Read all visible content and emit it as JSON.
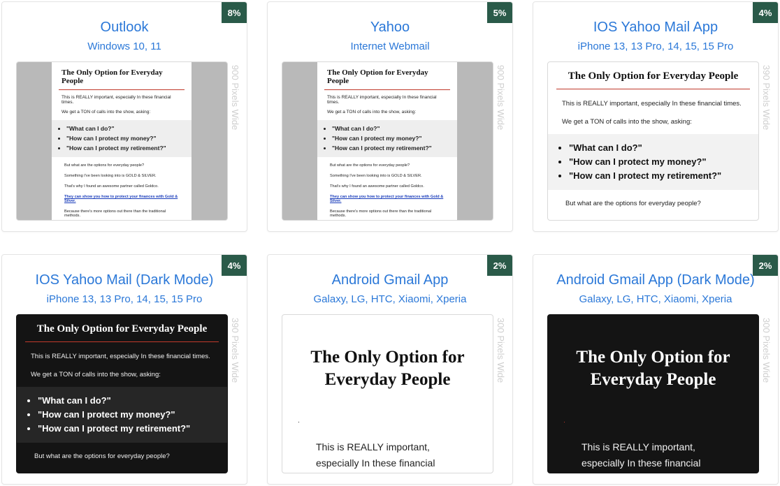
{
  "width_label": "Pixels Wide",
  "cards": [
    {
      "badge": "8%",
      "title": "Outlook",
      "subtitle": "Windows 10, 11",
      "width": "900"
    },
    {
      "badge": "5%",
      "title": "Yahoo",
      "subtitle": "Internet Webmail",
      "width": "900"
    },
    {
      "badge": "4%",
      "title": "IOS Yahoo Mail App",
      "subtitle": "iPhone 13, 13 Pro, 14, 15, 15 Pro",
      "width": "390"
    },
    {
      "badge": "4%",
      "title": "IOS Yahoo Mail (Dark Mode)",
      "subtitle": "iPhone 13, 13 Pro, 14, 15, 15 Pro",
      "width": "390"
    },
    {
      "badge": "2%",
      "title": "Android Gmail App",
      "subtitle": "Galaxy, LG, HTC, Xiaomi, Xperia",
      "width": "300"
    },
    {
      "badge": "2%",
      "title": "Android Gmail App (Dark Mode)",
      "subtitle": "Galaxy, LG, HTC, Xiaomi, Xperia",
      "width": "300"
    }
  ],
  "email": {
    "heading": "The Only Option for Everyday People",
    "intro": "This is REALLY important, especially In these financial times.",
    "calls": "We get a TON of calls into the show, asking:",
    "questions": [
      "\"What can I do?\"",
      "\"How can I protect my money?\"",
      "\"How can I protect my retirement?\""
    ],
    "options": "But what are the options for everyday people?",
    "looking": "Something I've been looking into is GOLD & SILVER.",
    "partner": "That's why I found an awesome partner called Goldco.",
    "link": "They can show you how to protect your finances with Gold & Silver.",
    "more": "Because there's more options out there than the traditional methods.",
    "android_body": "This is REALLY important, especially In these financial"
  },
  "colors": {
    "badge": "#2a5a49",
    "title": "#2b78d8",
    "rule": "#c0392b",
    "link": "#1a3dbb"
  }
}
